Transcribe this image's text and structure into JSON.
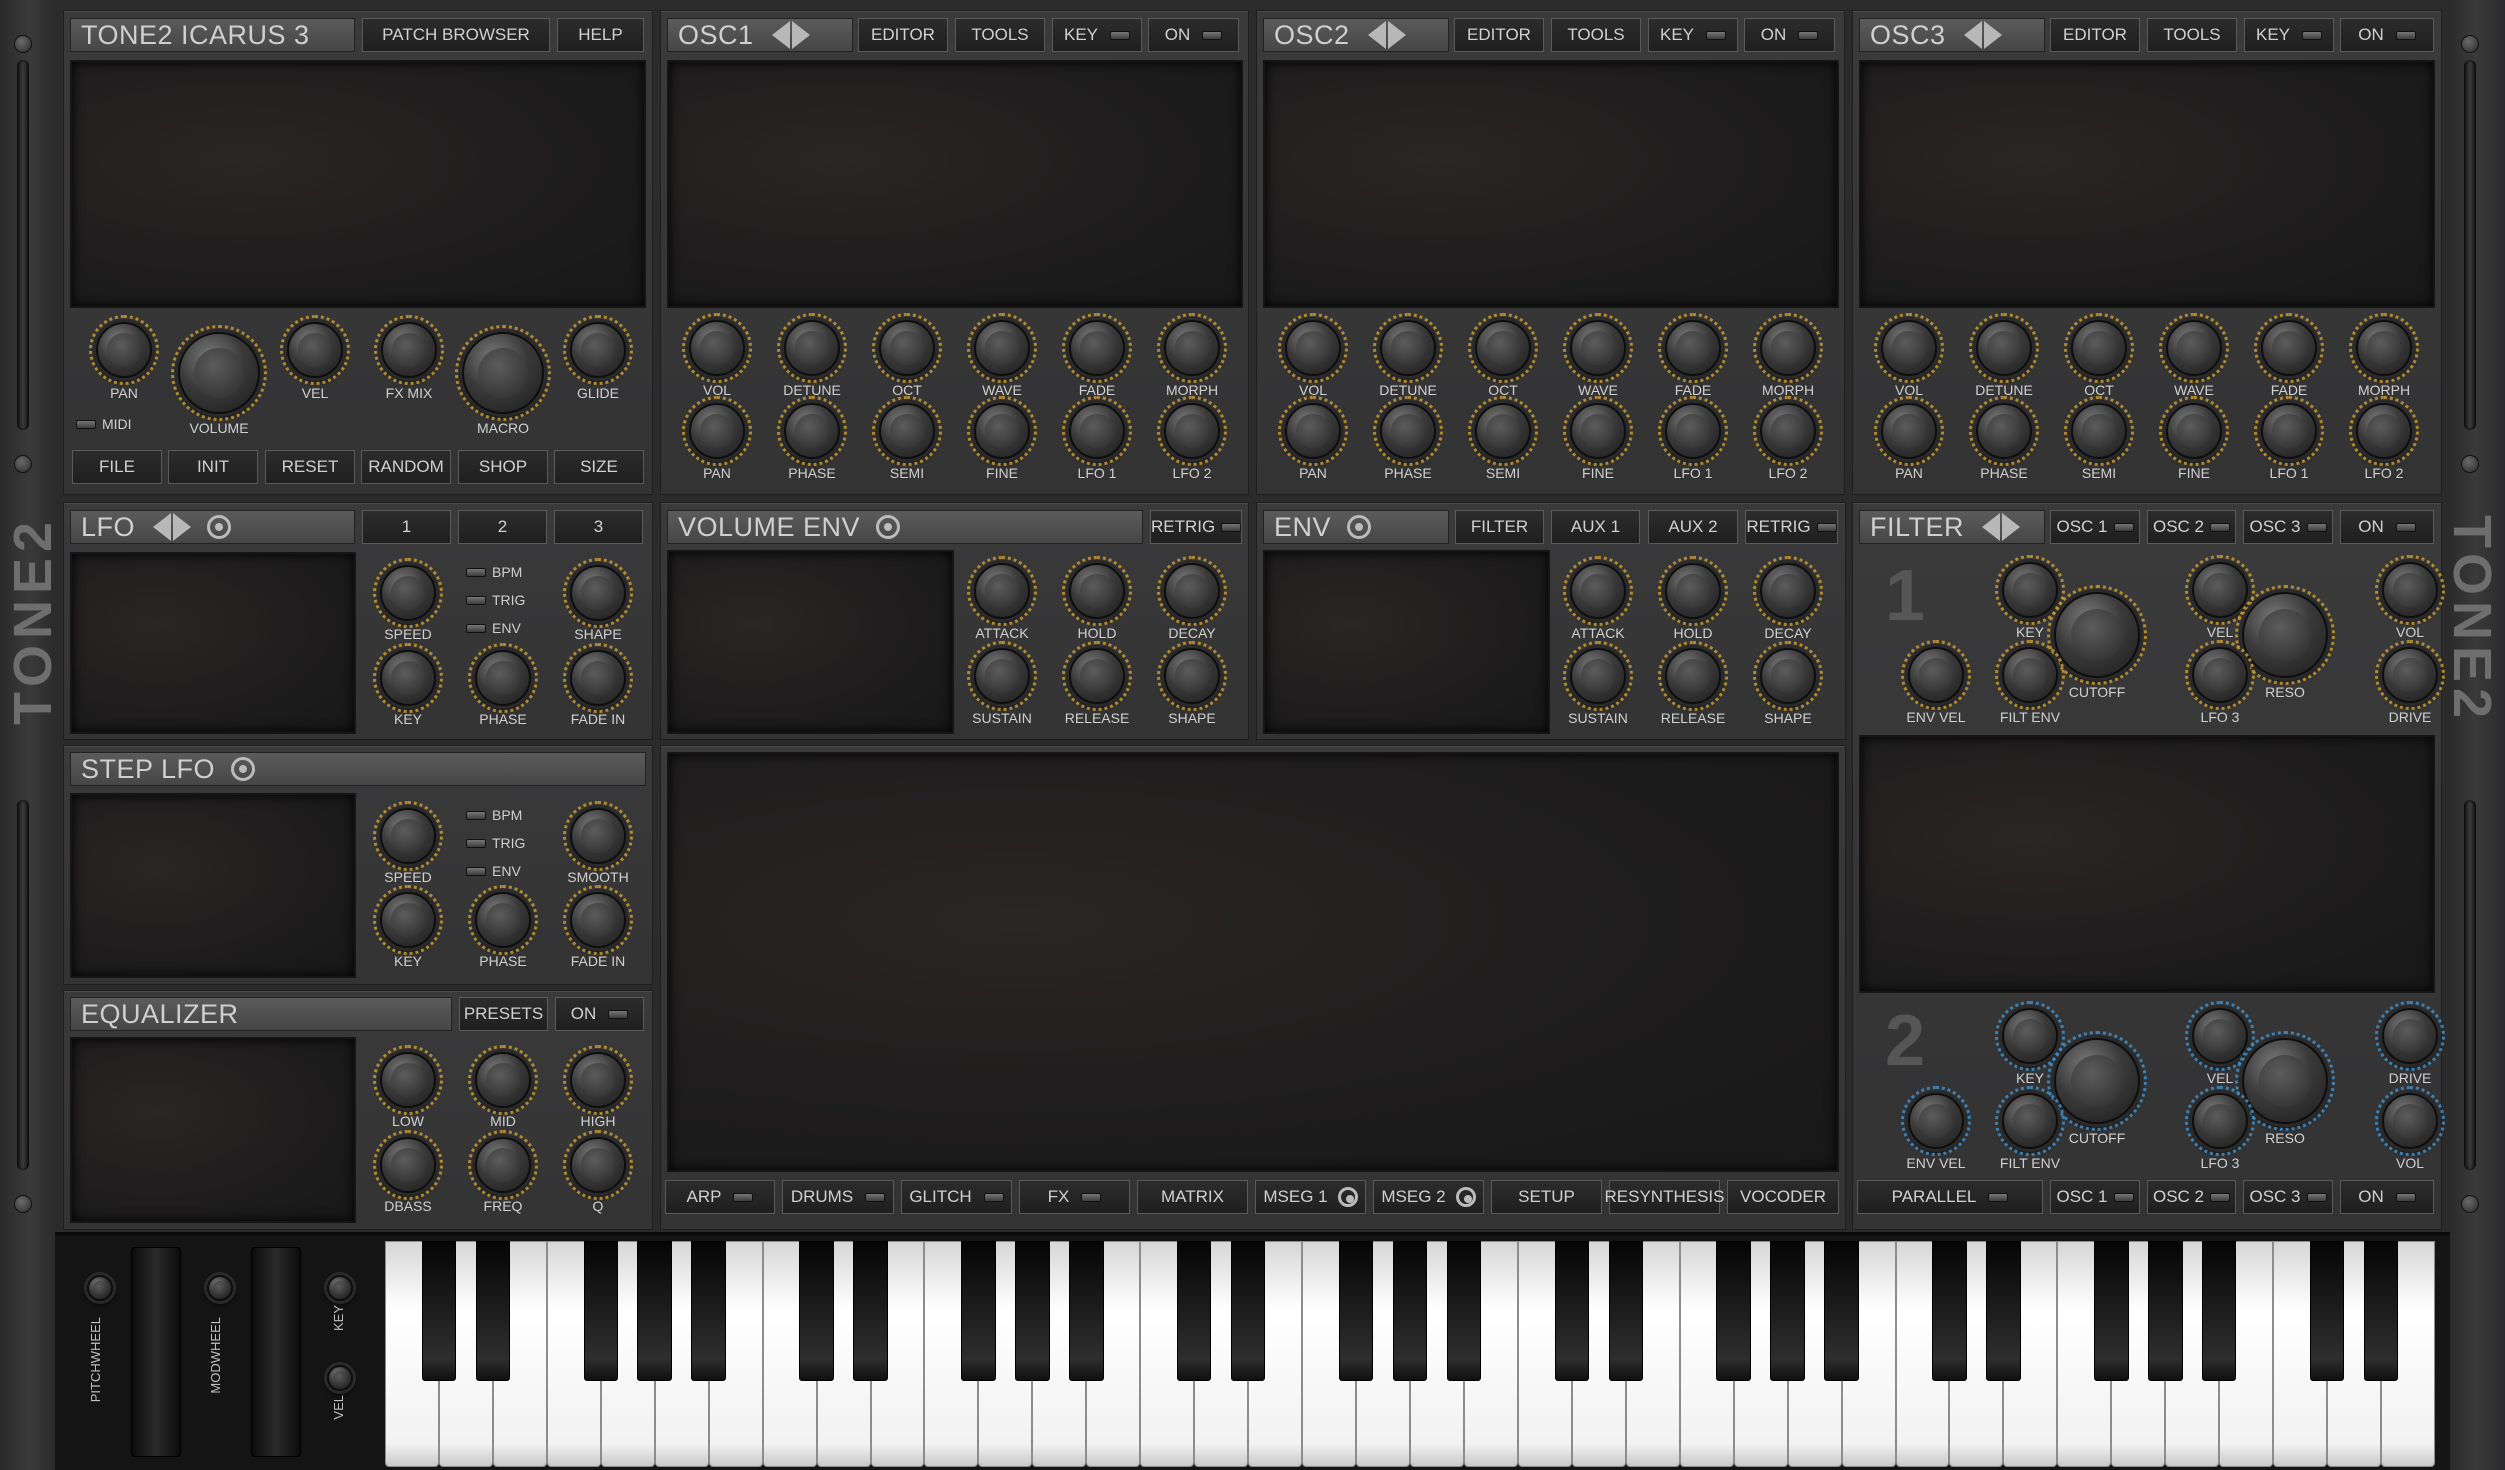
{
  "app": {
    "logo": "TONE2"
  },
  "master": {
    "title": "TONE2  ICARUS 3",
    "patch_browser": "PATCH BROWSER",
    "help": "HELP",
    "knobs": [
      "PAN",
      "VOLUME",
      "VEL",
      "FX MIX",
      "MACRO",
      "GLIDE"
    ],
    "midi": "MIDI",
    "buttons": [
      "FILE",
      "INIT",
      "RESET",
      "RANDOM",
      "SHOP",
      "SIZE"
    ]
  },
  "osc": [
    {
      "title": "OSC1",
      "editor": "EDITOR",
      "tools": "TOOLS",
      "key": "KEY",
      "on": "ON"
    },
    {
      "title": "OSC2",
      "editor": "EDITOR",
      "tools": "TOOLS",
      "key": "KEY",
      "on": "ON"
    },
    {
      "title": "OSC3",
      "editor": "EDITOR",
      "tools": "TOOLS",
      "key": "KEY",
      "on": "ON"
    }
  ],
  "osc_knobs_row1": [
    "VOL",
    "DETUNE",
    "OCT",
    "WAVE",
    "FADE",
    "MORPH"
  ],
  "osc_knobs_row2": [
    "PAN",
    "PHASE",
    "SEMI",
    "FINE",
    "LFO 1",
    "LFO 2"
  ],
  "lfo": {
    "title": "LFO",
    "tabs": [
      "1",
      "2",
      "3"
    ],
    "toggles": [
      "BPM",
      "TRIG",
      "ENV"
    ],
    "knobs": [
      "SPEED",
      "SHAPE",
      "KEY",
      "PHASE",
      "FADE IN"
    ]
  },
  "step_lfo": {
    "title": "STEP LFO",
    "toggles": [
      "BPM",
      "TRIG",
      "ENV"
    ],
    "knobs": [
      "SPEED",
      "SMOOTH",
      "KEY",
      "PHASE",
      "FADE IN"
    ]
  },
  "equalizer": {
    "title": "EQUALIZER",
    "presets": "PRESETS",
    "on": "ON",
    "knobs": [
      "LOW",
      "MID",
      "HIGH",
      "DBASS",
      "FREQ",
      "Q"
    ]
  },
  "volume_env": {
    "title": "VOLUME ENV",
    "retrig": "RETRIG",
    "knobs": [
      "ATTACK",
      "HOLD",
      "DECAY",
      "SUSTAIN",
      "RELEASE",
      "SHAPE"
    ]
  },
  "env": {
    "title": "ENV",
    "tabs": [
      "FILTER",
      "AUX 1",
      "AUX 2"
    ],
    "retrig": "RETRIG",
    "knobs": [
      "ATTACK",
      "HOLD",
      "DECAY",
      "SUSTAIN",
      "RELEASE",
      "SHAPE"
    ]
  },
  "filter": {
    "title": "FILTER",
    "osc_buttons": [
      "OSC 1",
      "OSC 2",
      "OSC 3"
    ],
    "on": "ON",
    "f1_number": "1",
    "f1_knobs": [
      "KEY",
      "CUTOFF",
      "VEL",
      "RESO",
      "VOL",
      "ENV VEL",
      "FILT ENV",
      "LFO 3",
      "DRIVE"
    ],
    "f2_number": "2",
    "f2_knobs": [
      "KEY",
      "CUTOFF",
      "VEL",
      "RESO",
      "DRIVE",
      "ENV VEL",
      "FILT ENV",
      "LFO 3",
      "VOL"
    ],
    "parallel": "PARALLEL"
  },
  "bottom_tabs": [
    "ARP",
    "DRUMS",
    "GLITCH",
    "FX",
    "MATRIX",
    "MSEG 1",
    "MSEG 2",
    "SETUP",
    "RESYNTHESIS",
    "VOCODER"
  ],
  "keyboard": {
    "pitchwheel": "PITCHWHEEL",
    "modwheel": "MODWHEEL",
    "key": "KEY",
    "vel": "VEL"
  }
}
